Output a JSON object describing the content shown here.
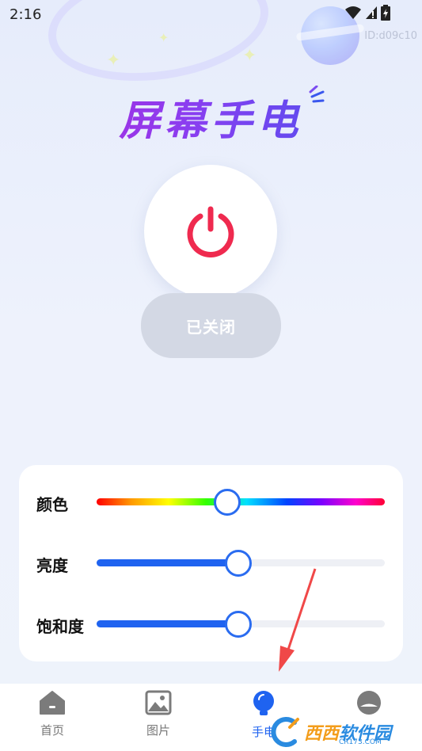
{
  "status_bar": {
    "time": "2:16",
    "id_text": "ID:d09c10"
  },
  "title": "屏幕手电",
  "power": {
    "state_label": "已关闭"
  },
  "controls": [
    {
      "label": "颜色",
      "value_percent": 45,
      "type": "hue"
    },
    {
      "label": "亮度",
      "value_percent": 49,
      "type": "level"
    },
    {
      "label": "饱和度",
      "value_percent": 49,
      "type": "level"
    }
  ],
  "nav": {
    "items": [
      {
        "label": "首页",
        "icon": "home-icon"
      },
      {
        "label": "图片",
        "icon": "image-icon"
      },
      {
        "label": "手电",
        "icon": "bulb-icon",
        "active": true
      },
      {
        "label": "",
        "icon": "profile-icon"
      }
    ]
  },
  "watermark": {
    "brand": "西西",
    "brand2": "软件园",
    "site": "CR173.COM"
  },
  "colors": {
    "accent": "#1f63f0",
    "power_red": "#ef2a4f",
    "title_start": "#b525d8",
    "title_end": "#3a57ee"
  }
}
